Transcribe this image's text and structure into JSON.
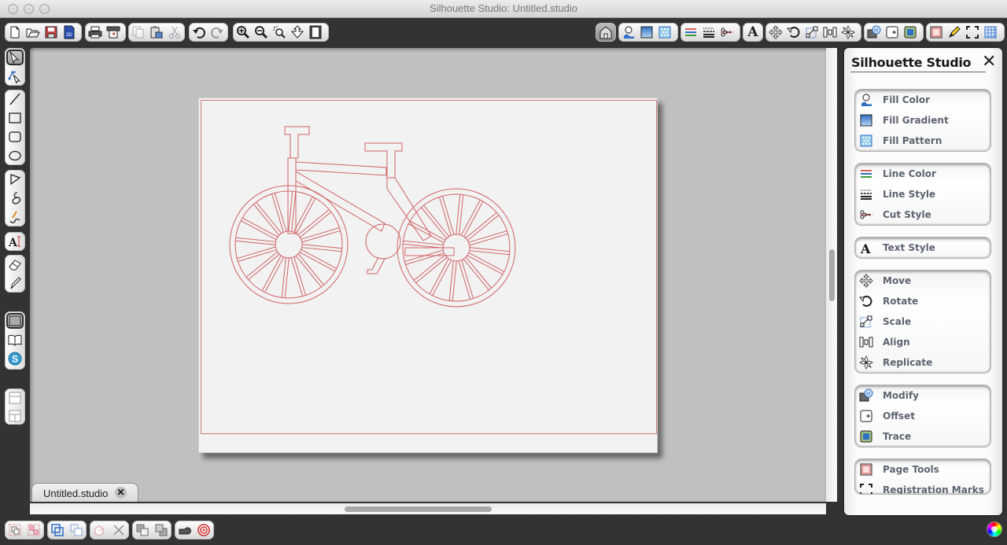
{
  "window": {
    "title": "Silhouette Studio: Untitled.studio"
  },
  "top_toolbar": {
    "file_group": [
      "new-document",
      "open-file",
      "save",
      "save-to-sd"
    ],
    "print_group": [
      "print",
      "send-to-silhouette"
    ],
    "edit_group": [
      "copy",
      "paste",
      "cut"
    ],
    "history_group": [
      "undo",
      "redo"
    ],
    "zoom_group": [
      "zoom-in",
      "zoom-out",
      "zoom-select",
      "pan-drag",
      "fit-to-page"
    ],
    "right_groups": [
      [
        "library-home"
      ],
      [
        "fill-color",
        "fill-gradient",
        "fill-pattern"
      ],
      [
        "line-color",
        "line-style",
        "cut-style"
      ],
      [
        "text-style"
      ],
      [
        "move",
        "rotate",
        "scale",
        "align",
        "replicate"
      ],
      [
        "modify",
        "offset",
        "trace"
      ],
      [
        "page-tools",
        "pencil-sketch",
        "registration-marks",
        "grid"
      ]
    ]
  },
  "left_toolbar": {
    "groups": [
      [
        "select-arrow",
        "edit-points"
      ],
      [
        "draw-line",
        "draw-rectangle",
        "draw-rounded-rectangle",
        "draw-ellipse"
      ],
      [
        "draw-polygon",
        "draw-curve",
        "freehand-draw"
      ],
      [
        "text-tool"
      ],
      [
        "eraser",
        "knife"
      ],
      [
        "design-view",
        "library",
        "silhouette-store"
      ],
      [
        "single-panel-view",
        "split-panel-view"
      ]
    ]
  },
  "document_tab": {
    "label": "Untitled.studio",
    "close_symbol": "✕"
  },
  "canvas": {
    "design_name": "bicycle-outline",
    "cut_line_color": "#d06464",
    "page_color": "#f2f2f2",
    "workspace_color": "#c0c0c0"
  },
  "bottom_toolbar": {
    "groups": [
      [
        "group",
        "ungroup"
      ],
      [
        "make-compound-path",
        "release-compound-path"
      ],
      [
        "weld",
        "delete"
      ],
      [
        "bring-to-front",
        "send-to-back"
      ],
      [
        "modify-shape",
        "target"
      ]
    ]
  },
  "panel": {
    "title": "Silhouette Studio",
    "close_symbol": "✕",
    "groups": [
      {
        "items": [
          {
            "label": "Fill Color",
            "icon": "fill-color"
          },
          {
            "label": "Fill Gradient",
            "icon": "fill-gradient"
          },
          {
            "label": "Fill Pattern",
            "icon": "fill-pattern"
          }
        ]
      },
      {
        "items": [
          {
            "label": "Line Color",
            "icon": "line-color"
          },
          {
            "label": "Line Style",
            "icon": "line-style"
          },
          {
            "label": "Cut Style",
            "icon": "cut-style"
          }
        ]
      },
      {
        "items": [
          {
            "label": "Text Style",
            "icon": "text-style"
          }
        ]
      },
      {
        "items": [
          {
            "label": "Move",
            "icon": "move"
          },
          {
            "label": "Rotate",
            "icon": "rotate"
          },
          {
            "label": "Scale",
            "icon": "scale"
          },
          {
            "label": "Align",
            "icon": "align"
          },
          {
            "label": "Replicate",
            "icon": "replicate"
          }
        ]
      },
      {
        "items": [
          {
            "label": "Modify",
            "icon": "modify"
          },
          {
            "label": "Offset",
            "icon": "offset"
          },
          {
            "label": "Trace",
            "icon": "trace"
          }
        ]
      },
      {
        "items": [
          {
            "label": "Page Tools",
            "icon": "page-tools"
          },
          {
            "label": "Registration Marks",
            "icon": "registration-marks"
          }
        ]
      }
    ]
  },
  "colors": {
    "chrome_dark": "#333333",
    "panel_label": "#5c6470",
    "accent_blue": "#2f6fc4"
  }
}
